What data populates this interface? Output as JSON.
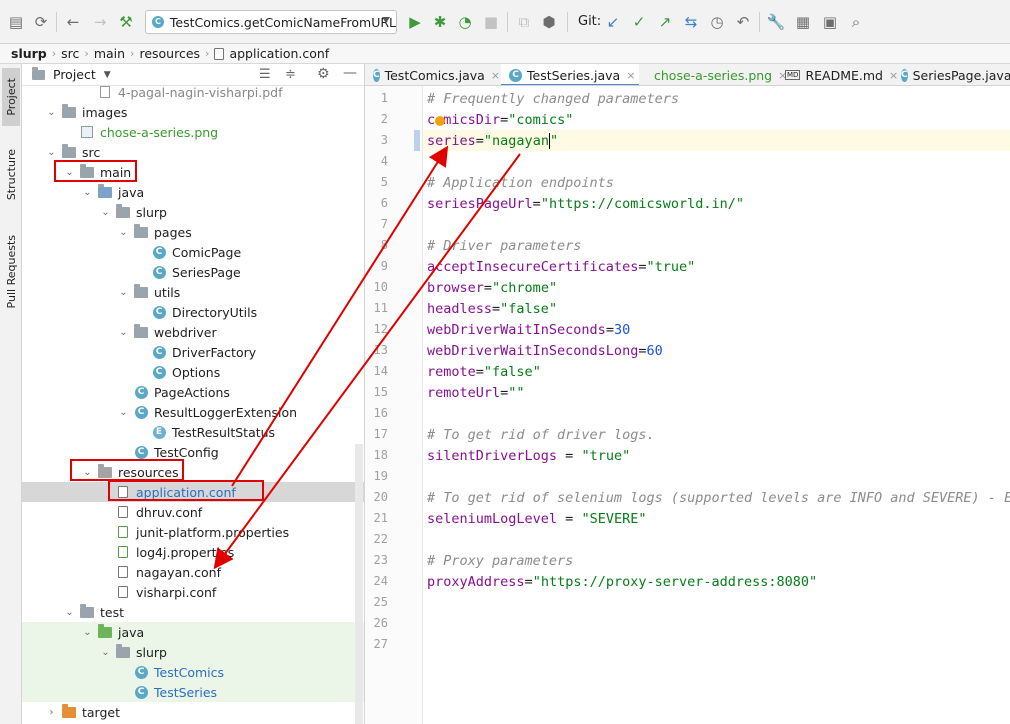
{
  "toolbar": {
    "run_config_label": "TestComics.getComicNameFromURL",
    "git_label": "Git:"
  },
  "breadcrumb": [
    "slurp",
    "src",
    "main",
    "resources",
    "application.conf"
  ],
  "toolwindows": {
    "project": "Project",
    "structure": "Structure",
    "pull_requests": "Pull Requests"
  },
  "project_panel": {
    "title": "Project",
    "tree": [
      {
        "name": "4-pagal-nagin-visharpi.pdf",
        "depth": 3,
        "kind": "pdf",
        "expanded": null,
        "style": "dim"
      },
      {
        "name": "images",
        "depth": 1,
        "kind": "folder",
        "expanded": true
      },
      {
        "name": "chose-a-series.png",
        "depth": 2,
        "kind": "image",
        "style": "g"
      },
      {
        "name": "src",
        "depth": 1,
        "kind": "folder",
        "expanded": true
      },
      {
        "name": "main",
        "depth": 2,
        "kind": "folder",
        "expanded": true,
        "boxed": true
      },
      {
        "name": "java",
        "depth": 3,
        "kind": "folder-blue",
        "expanded": true
      },
      {
        "name": "slurp",
        "depth": 4,
        "kind": "folder",
        "expanded": true
      },
      {
        "name": "pages",
        "depth": 5,
        "kind": "folder",
        "expanded": true
      },
      {
        "name": "ComicPage",
        "depth": 6,
        "kind": "class"
      },
      {
        "name": "SeriesPage",
        "depth": 6,
        "kind": "class"
      },
      {
        "name": "utils",
        "depth": 5,
        "kind": "folder",
        "expanded": true
      },
      {
        "name": "DirectoryUtils",
        "depth": 6,
        "kind": "class"
      },
      {
        "name": "webdriver",
        "depth": 5,
        "kind": "folder",
        "expanded": true
      },
      {
        "name": "DriverFactory",
        "depth": 6,
        "kind": "class"
      },
      {
        "name": "Options",
        "depth": 6,
        "kind": "class"
      },
      {
        "name": "PageActions",
        "depth": 5,
        "kind": "class"
      },
      {
        "name": "ResultLoggerExtension",
        "depth": 5,
        "kind": "class",
        "expanded": true
      },
      {
        "name": "TestResultStatus",
        "depth": 6,
        "kind": "enum"
      },
      {
        "name": "TestConfig",
        "depth": 5,
        "kind": "class"
      },
      {
        "name": "resources",
        "depth": 3,
        "kind": "folder-res",
        "expanded": true,
        "boxed": true
      },
      {
        "name": "application.conf",
        "depth": 4,
        "kind": "conf",
        "selected": true,
        "boxed": true,
        "style": "b"
      },
      {
        "name": "dhruv.conf",
        "depth": 4,
        "kind": "conf"
      },
      {
        "name": "junit-platform.properties",
        "depth": 4,
        "kind": "props"
      },
      {
        "name": "log4j.properties",
        "depth": 4,
        "kind": "props"
      },
      {
        "name": "nagayan.conf",
        "depth": 4,
        "kind": "conf"
      },
      {
        "name": "visharpi.conf",
        "depth": 4,
        "kind": "conf"
      },
      {
        "name": "test",
        "depth": 2,
        "kind": "folder",
        "expanded": true
      },
      {
        "name": "java",
        "depth": 3,
        "kind": "folder-green",
        "expanded": true,
        "test": true
      },
      {
        "name": "slurp",
        "depth": 4,
        "kind": "folder",
        "expanded": true,
        "test": true
      },
      {
        "name": "TestComics",
        "depth": 5,
        "kind": "class",
        "test": true,
        "style": "b"
      },
      {
        "name": "TestSeries",
        "depth": 5,
        "kind": "class",
        "test": true,
        "style": "b"
      },
      {
        "name": "target",
        "depth": 1,
        "kind": "folder-orange",
        "expanded": false
      }
    ]
  },
  "tabs": [
    {
      "label": "TestComics.java",
      "icon": "class",
      "active": false
    },
    {
      "label": "TestSeries.java",
      "icon": "class",
      "active": true
    },
    {
      "label": "chose-a-series.png",
      "icon": "image",
      "active": false
    },
    {
      "label": "README.md",
      "icon": "markdown",
      "active": false
    },
    {
      "label": "SeriesPage.java",
      "icon": "class",
      "active": false
    }
  ],
  "code_lines": [
    {
      "comment": "# Frequently changed parameters"
    },
    {
      "key": "comicsDir",
      "op": "=",
      "val": "\"comics\""
    },
    {
      "key": "series",
      "op": "=",
      "val": "\"nagayan\"",
      "current": true
    },
    {},
    {
      "comment": "# Application endpoints"
    },
    {
      "key": "seriesPageUrl",
      "op": "=",
      "val": "\"https://comicsworld.in/\""
    },
    {},
    {
      "comment": "# Driver parameters"
    },
    {
      "key": "acceptInsecureCertificates",
      "op": "=",
      "val": "\"true\""
    },
    {
      "key": "browser",
      "op": "=",
      "val": "\"chrome\""
    },
    {
      "key": "headless",
      "op": "=",
      "val": "\"false\""
    },
    {
      "key": "webDriverWaitInSeconds",
      "op": "=",
      "num": "30"
    },
    {
      "key": "webDriverWaitInSecondsLong",
      "op": "=",
      "num": "60"
    },
    {
      "key": "remote",
      "op": "=",
      "val": "\"false\""
    },
    {
      "key": "remoteUrl",
      "op": "=",
      "val": "\"\""
    },
    {},
    {
      "comment": "# To get rid of driver logs."
    },
    {
      "key": "silentDriverLogs",
      "op": " = ",
      "val": "\"true\""
    },
    {},
    {
      "comment": "# To get rid of selenium logs (supported levels are INFO and SEVERE) - ER"
    },
    {
      "key": "seleniumLogLevel",
      "op": " = ",
      "val": "\"SEVERE\""
    },
    {},
    {
      "comment": "# Proxy parameters"
    },
    {
      "key": "proxyAddress",
      "op": "=",
      "val": "\"https://proxy-server-address:8080\""
    },
    {},
    {},
    {}
  ],
  "colors": {
    "annotation": "#e00000",
    "selection": "#d7d7d7",
    "test_bg": "#ecf6e8"
  }
}
